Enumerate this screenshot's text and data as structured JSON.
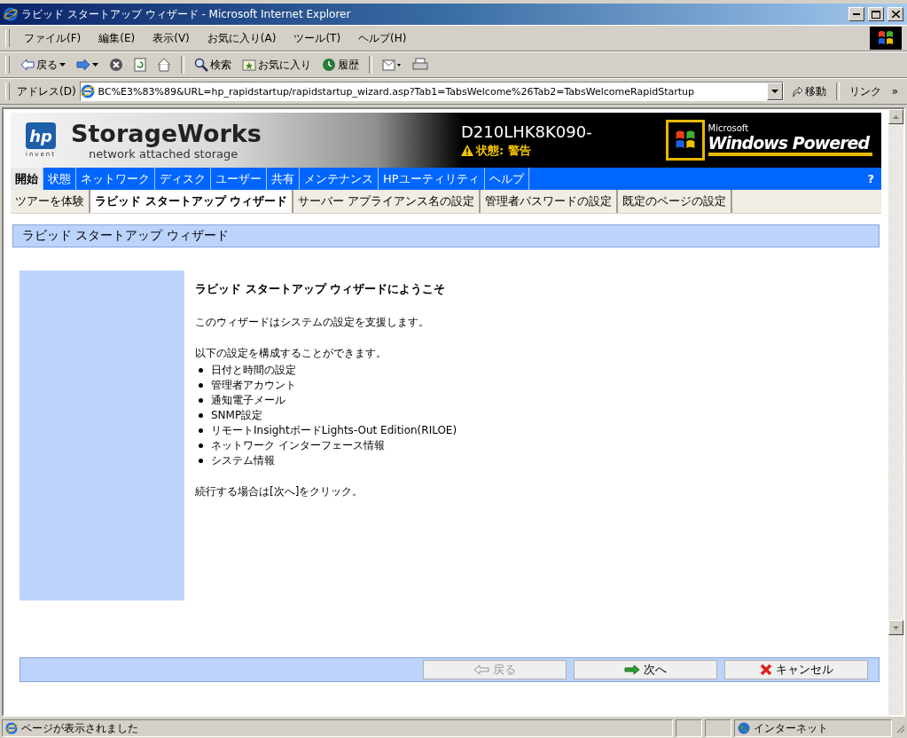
{
  "window": {
    "title": "ラビッド スタートアップ ウィザード - Microsoft Internet Explorer"
  },
  "menu": [
    "ファイル(F)",
    "編集(E)",
    "表示(V)",
    "お気に入り(A)",
    "ツール(T)",
    "ヘルプ(H)"
  ],
  "toolbar": [
    {
      "kind": "back",
      "label": "戻る"
    },
    {
      "kind": "forward"
    },
    {
      "kind": "stop"
    },
    {
      "kind": "refresh"
    },
    {
      "kind": "home"
    },
    {
      "kind": "search",
      "label": "検索"
    },
    {
      "kind": "favorites",
      "label": "お気に入り"
    },
    {
      "kind": "history",
      "label": "履歴"
    },
    {
      "kind": "mail"
    },
    {
      "kind": "print"
    }
  ],
  "address": {
    "label": "アドレス(D)",
    "value": "BC%E3%83%89&URL=hp_rapidstartup/rapidstartup_wizard.asp?Tab1=TabsWelcome%26Tab2=TabsWelcomeRapidStartup",
    "go": "移動",
    "links": "リンク",
    "more": "»"
  },
  "banner": {
    "logo": "hp",
    "logo_tag": "invent",
    "brand": "StorageWorks",
    "tagline": "network attached storage",
    "device": "D210LHK8K090-",
    "status": "状態: 警告",
    "ms": "Microsoft",
    "powered": "Windows Powered"
  },
  "nav": {
    "items": [
      {
        "label": "開始",
        "selected": true
      },
      {
        "label": "状態",
        "selected": false
      },
      {
        "label": "ネットワーク",
        "selected": false
      },
      {
        "label": "ディスク",
        "selected": false
      },
      {
        "label": "ユーザー",
        "selected": false
      },
      {
        "label": "共有",
        "selected": false
      },
      {
        "label": "メンテナンス",
        "selected": false
      },
      {
        "label": "HPユーティリティ",
        "selected": false
      },
      {
        "label": "ヘルプ",
        "selected": false
      }
    ],
    "help": "?"
  },
  "subnav": [
    {
      "label": "ツアーを体験",
      "selected": false
    },
    {
      "label": "ラビッド スタートアップ ウィザード",
      "selected": true
    },
    {
      "label": "サーバー アプライアンス名の設定",
      "selected": false
    },
    {
      "label": "管理者パスワードの設定",
      "selected": false
    },
    {
      "label": "既定のページの設定",
      "selected": false
    }
  ],
  "section_title": "ラビッド スタートアップ ウィザード",
  "content": {
    "heading": "ラビッド スタートアップ ウィザードにようこそ",
    "intro": "このウィザードはシステムの設定を支援します。",
    "list_intro": "以下の設定を構成することができます。",
    "items": [
      "日付と時間の設定",
      "管理者アカウント",
      "通知電子メール",
      "SNMP設定",
      "リモートInsightボードLights-Out Edition(RILOE)",
      "ネットワーク インターフェース情報",
      "システム情報"
    ],
    "footer": "続行する場合は[次へ]をクリック。"
  },
  "buttons": [
    {
      "kind": "back",
      "label": "戻る",
      "disabled": true
    },
    {
      "kind": "next",
      "label": "次へ",
      "disabled": false
    },
    {
      "kind": "cancel",
      "label": "キャンセル",
      "disabled": false
    }
  ],
  "status_bar": {
    "text": "ページが表示されました",
    "zone": "インターネット"
  }
}
